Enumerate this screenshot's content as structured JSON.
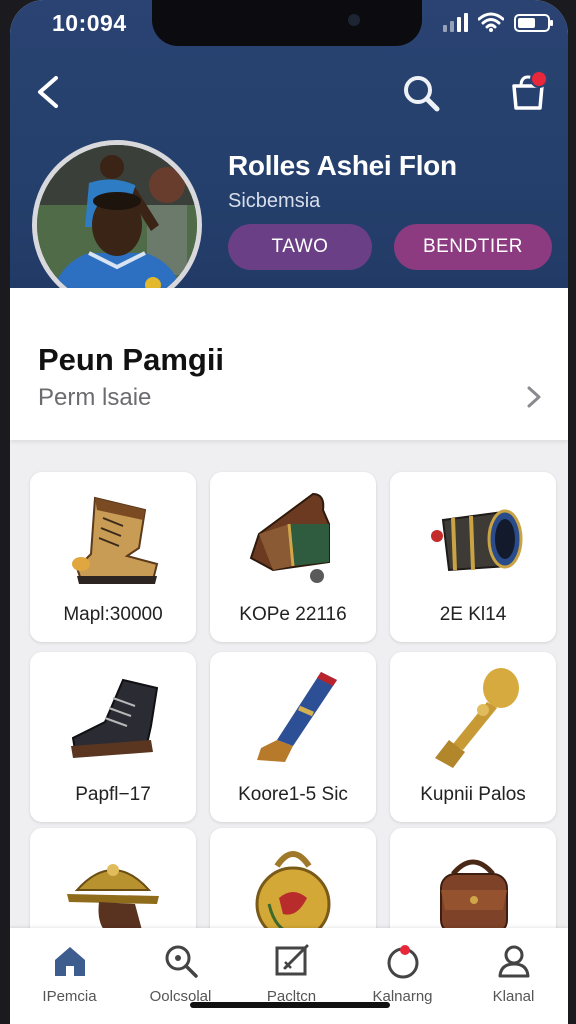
{
  "status": {
    "time": "10:094",
    "signal_bars": 4,
    "signal_active": 2,
    "battery_level": 0.6
  },
  "header": {
    "back_icon": "chevron-left-icon",
    "search_icon": "search-icon",
    "cart_icon": "shopping-bag-icon",
    "cart_badge_color": "#e8283a"
  },
  "profile": {
    "name": "Rolles Ashei Flon",
    "subtitle": "Sicbemsia",
    "buttons": [
      "TAWO",
      "BENDTIER"
    ]
  },
  "section": {
    "title": "Peun Pamgii",
    "subtitle": "Perm lsaie"
  },
  "products": [
    {
      "label": "Mapl:30000",
      "icon": "boot-icon"
    },
    {
      "label": "KOPe 22116",
      "icon": "bag-icon"
    },
    {
      "label": "2E Kl14",
      "icon": "canister-icon"
    },
    {
      "label": "Papfl−17",
      "icon": "shoe-icon"
    },
    {
      "label": "Koore1-5 Sic",
      "icon": "horn-icon"
    },
    {
      "label": "Kupnii Palos",
      "icon": "trophy-icon"
    },
    {
      "label": "",
      "icon": "helmet-icon"
    },
    {
      "label": "",
      "icon": "kettlebell-icon"
    },
    {
      "label": "",
      "icon": "satchel-icon"
    }
  ],
  "tabs": [
    {
      "label": "IPemcia",
      "icon": "home-icon",
      "active": true
    },
    {
      "label": "Oolcsolal",
      "icon": "search-icon",
      "active": false
    },
    {
      "label": "Pacltcn",
      "icon": "edit-icon",
      "active": false
    },
    {
      "label": "Kalnarng",
      "icon": "timer-icon",
      "active": false
    },
    {
      "label": "Klanal",
      "icon": "user-icon",
      "active": false
    }
  ],
  "colors": {
    "header_bg": "#25406d",
    "accent_purple": "#6a3f86",
    "accent_magenta": "#8c3b80",
    "active_tab": "#3d5d8e"
  }
}
